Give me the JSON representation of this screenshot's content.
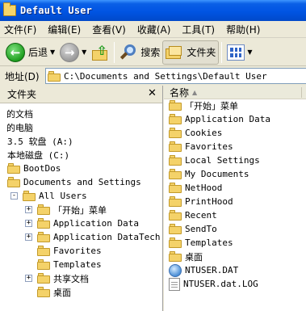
{
  "window": {
    "title": "Default User"
  },
  "menu": [
    {
      "label": "文件(F)"
    },
    {
      "label": "编辑(E)"
    },
    {
      "label": "查看(V)"
    },
    {
      "label": "收藏(A)"
    },
    {
      "label": "工具(T)"
    },
    {
      "label": "帮助(H)"
    }
  ],
  "toolbar": {
    "back_label": "后退",
    "search_label": "搜索",
    "folders_label": "文件夹"
  },
  "address": {
    "label": "地址(D)",
    "value": "C:\\Documents and Settings\\Default User"
  },
  "left_pane": {
    "title": "文件夹",
    "tree": [
      {
        "label": "的文档",
        "icon": "none",
        "expander": ""
      },
      {
        "label": "的电脑",
        "icon": "none",
        "expander": ""
      },
      {
        "label": "3.5 软盘 (A:)",
        "icon": "none",
        "expander": ""
      },
      {
        "label": "本地磁盘 (C:)",
        "icon": "none",
        "expander": ""
      },
      {
        "label": "BootDos",
        "icon": "folder",
        "expander": ""
      },
      {
        "label": "Documents and Settings",
        "icon": "folder",
        "expander": ""
      },
      {
        "label": "All Users",
        "icon": "folder",
        "expander": "-"
      },
      {
        "label": "「开始」菜单",
        "icon": "folder",
        "expander": "+"
      },
      {
        "label": "Application Data",
        "icon": "folder",
        "expander": "+"
      },
      {
        "label": "Application DataTech",
        "icon": "folder",
        "expander": "+"
      },
      {
        "label": "Favorites",
        "icon": "folder",
        "expander": ""
      },
      {
        "label": "Templates",
        "icon": "folder",
        "expander": ""
      },
      {
        "label": "共享文档",
        "icon": "folder",
        "expander": "+"
      },
      {
        "label": "桌面",
        "icon": "folder",
        "expander": ""
      }
    ]
  },
  "right_pane": {
    "column_name": "名称",
    "items": [
      {
        "label": "「开始」菜单",
        "icon": "folder"
      },
      {
        "label": "Application Data",
        "icon": "folder"
      },
      {
        "label": "Cookies",
        "icon": "folder"
      },
      {
        "label": "Favorites",
        "icon": "folder"
      },
      {
        "label": "Local Settings",
        "icon": "folder"
      },
      {
        "label": "My Documents",
        "icon": "folder"
      },
      {
        "label": "NetHood",
        "icon": "folder"
      },
      {
        "label": "PrintHood",
        "icon": "folder"
      },
      {
        "label": "Recent",
        "icon": "folder"
      },
      {
        "label": "SendTo",
        "icon": "folder"
      },
      {
        "label": "Templates",
        "icon": "folder"
      },
      {
        "label": "桌面",
        "icon": "folder"
      },
      {
        "label": "NTUSER.DAT",
        "icon": "dat"
      },
      {
        "label": "NTUSER.dat.LOG",
        "icon": "file"
      }
    ]
  }
}
